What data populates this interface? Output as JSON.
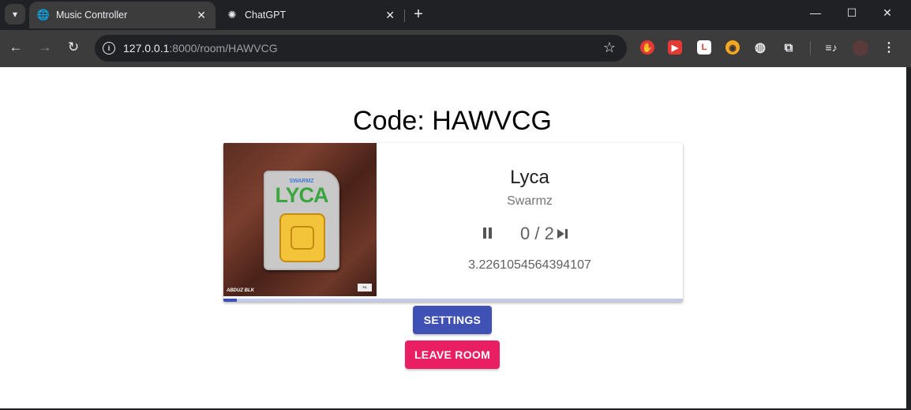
{
  "browser": {
    "tabs": [
      {
        "title": "Music Controller",
        "icon": "globe-icon",
        "active": true
      },
      {
        "title": "ChatGPT",
        "icon": "chatgpt-icon",
        "active": false
      }
    ],
    "url_host": "127.0.0.1",
    "url_path": ":8000/room/HAWVCG",
    "extensions": [
      {
        "name": "adblock-icon",
        "color": "#e53935",
        "glyph": "✋"
      },
      {
        "name": "youtube-ext-icon",
        "color": "#e53935",
        "glyph": "▶"
      },
      {
        "name": "l-ext-icon",
        "color": "#ffffff",
        "glyph": "L"
      },
      {
        "name": "owl-ext-icon",
        "color": "#f5a623",
        "glyph": "◉"
      },
      {
        "name": "globe-ext-icon",
        "color": "#e8eaed",
        "glyph": "◍"
      },
      {
        "name": "puzzle-icon",
        "color": "#e8eaed",
        "glyph": "⧉"
      }
    ]
  },
  "page": {
    "code_title": "Code: HAWVCG",
    "settings_label": "SETTINGS",
    "leave_label": "LEAVE ROOM"
  },
  "player": {
    "title": "Lyca",
    "artist": "Swarmz",
    "votes": "0 / 2",
    "elapsed": "3.2261054564394107",
    "progress_fraction": 0.03,
    "album": {
      "brand": "SWARMZ",
      "title": "LYCA",
      "footer": "ABDUZ BLK"
    }
  },
  "colors": {
    "primary": "#3f51b5",
    "secondary": "#e91e63"
  }
}
